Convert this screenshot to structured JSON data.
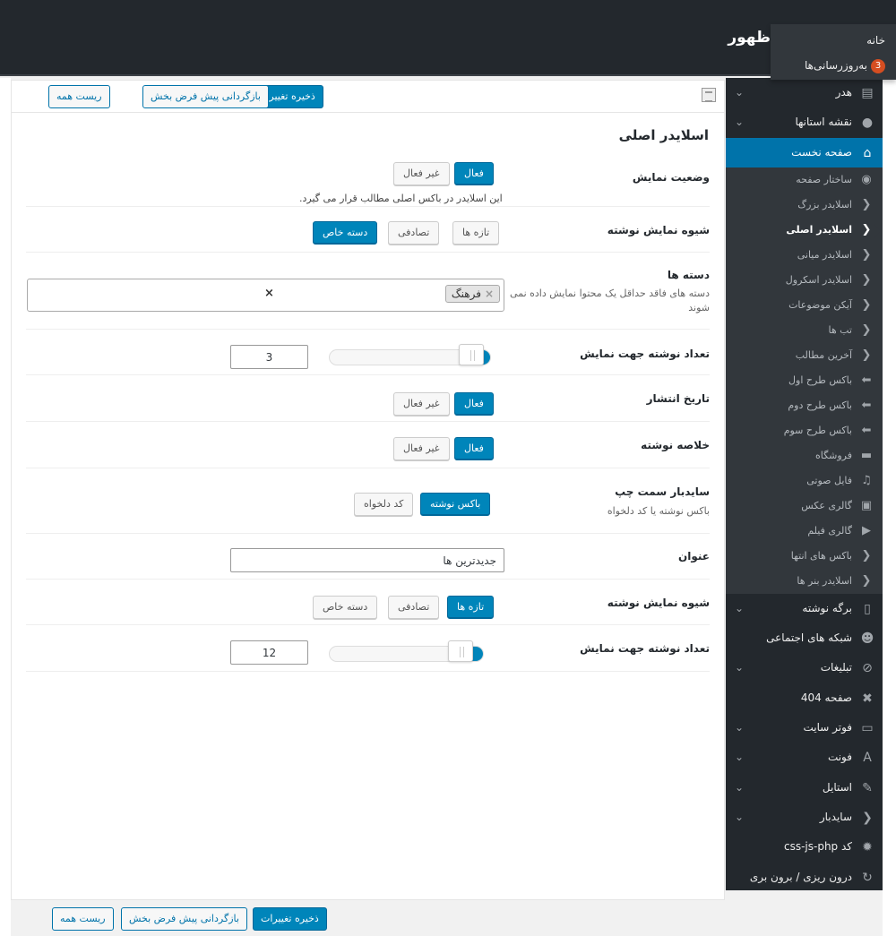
{
  "site": {
    "title": "ظهور"
  },
  "top_dropdown": {
    "home": "خانه",
    "updates": "به‌روزرسانی‌ها",
    "updates_count": "3"
  },
  "toolbar": {
    "save": "ذخیره تغییرات",
    "restore_section": "بازگردانی پیش فرض بخش",
    "reset_all": "ریست همه"
  },
  "section": {
    "title": "اسلایدر اصلی",
    "display_status": {
      "label": "وضعیت نمایش",
      "on": "فعال",
      "off": "غیر فعال",
      "note": "این اسلایدر در باکس اصلی مطالب قرار می گیرد."
    },
    "post_display_mode": {
      "label": "شیوه نمایش نوشته",
      "latest": "تازه ها",
      "random": "تصادفی",
      "category": "دسته خاص"
    },
    "categories": {
      "label": "دسته ها",
      "desc": "دسته های فاقد حداقل یک محتوا نمایش داده نمی شوند",
      "tag": "فرهنگ",
      "tag_remove": "×",
      "clear": "×"
    },
    "post_count": {
      "label": "تعداد نوشته جهت نمایش",
      "value": "3",
      "fraction": 0.12
    },
    "publish_date": {
      "label": "تاریخ انتشار",
      "on": "فعال",
      "off": "غیر فعال"
    },
    "excerpt": {
      "label": "خلاصه نوشته",
      "on": "فعال",
      "off": "غیر فعال"
    },
    "left_sidebar": {
      "label": "سایدبار سمت چپ",
      "desc": "باکس نوشته یا کد دلخواه",
      "post_box": "باکس نوشته",
      "custom_code": "کد دلخواه"
    },
    "heading": {
      "label": "عنوان",
      "value": "جدیدترین ها"
    },
    "post_display_mode_2": {
      "label": "شیوه نمایش نوشته",
      "latest": "تازه ها",
      "random": "تصادفی",
      "category": "دسته خاص"
    },
    "post_count_2": {
      "label": "تعداد نوشته جهت نمایش",
      "value": "12",
      "fraction": 0.15
    }
  },
  "sidebar": {
    "items": [
      {
        "label": "هدر",
        "icon": "layout-icon"
      },
      {
        "label": "نقشه استانها",
        "icon": "map-pin-icon"
      },
      {
        "label": "صفحه نخست",
        "icon": "home-icon"
      }
    ],
    "subitems": [
      {
        "label": "ساختار صفحه",
        "icon": "wordpress-icon"
      },
      {
        "label": "اسلایدر بزرگ",
        "icon": "chevron-left-icon"
      },
      {
        "label": "اسلایدر اصلی",
        "icon": "chevron-left-icon"
      },
      {
        "label": "اسلایدر میانی",
        "icon": "chevron-left-icon"
      },
      {
        "label": "اسلایدر اسکرول",
        "icon": "chevron-left-icon"
      },
      {
        "label": "آیکن موضوعات",
        "icon": "chevron-left-icon"
      },
      {
        "label": "تب ها",
        "icon": "chevron-left-icon"
      },
      {
        "label": "آخرین مطالب",
        "icon": "chevron-left-icon"
      },
      {
        "label": "باکس طرح اول",
        "icon": "arrow-left-icon"
      },
      {
        "label": "باکس طرح دوم",
        "icon": "arrow-left-icon"
      },
      {
        "label": "باکس طرح سوم",
        "icon": "arrow-left-icon"
      },
      {
        "label": "فروشگاه",
        "icon": "cart-icon"
      },
      {
        "label": "فایل صوتی",
        "icon": "music-icon"
      },
      {
        "label": "گالری عکس",
        "icon": "image-icon"
      },
      {
        "label": "گالری فیلم",
        "icon": "video-icon"
      },
      {
        "label": "باکس های انتها",
        "icon": "chevron-left-icon"
      },
      {
        "label": "اسلایدر بنر ها",
        "icon": "chevron-left-icon"
      }
    ],
    "bottom_items": [
      {
        "label": "برگه نوشته",
        "icon": "page-icon"
      },
      {
        "label": "شبکه های اجتماعی",
        "icon": "users-icon"
      },
      {
        "label": "تبلیغات",
        "icon": "paperclip-icon"
      },
      {
        "label": "صفحه 404",
        "icon": "close-icon"
      },
      {
        "label": "فوتر سایت",
        "icon": "monitor-icon"
      },
      {
        "label": "فونت",
        "icon": "font-icon"
      },
      {
        "label": "استایل",
        "icon": "brush-icon"
      },
      {
        "label": "سایدبار",
        "icon": "chevron-left-icon"
      },
      {
        "label": "کد css-js-php",
        "icon": "gear-icon"
      },
      {
        "label": "درون ریزی / برون بری",
        "icon": "refresh-icon"
      }
    ]
  },
  "colors": {
    "primary": "#0085ba",
    "sidebar_bg": "#23282d",
    "submenu_bg": "#32373c",
    "active": "#0073aa"
  }
}
